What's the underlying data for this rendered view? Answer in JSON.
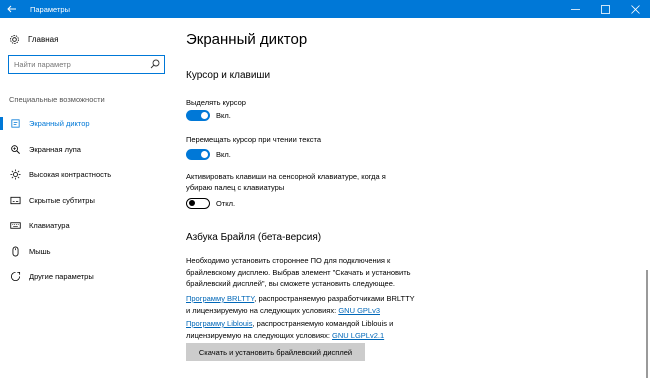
{
  "window": {
    "title": "Параметры",
    "back_icon": "back-arrow-icon",
    "controls": [
      "minimize",
      "maximize",
      "close"
    ]
  },
  "sidebar": {
    "home_label": "Главная",
    "search_placeholder": "Найти параметр",
    "section_header": "Специальные возможности",
    "items": [
      {
        "label": "Экранный диктор",
        "icon": "narrator-icon",
        "active": true
      },
      {
        "label": "Экранная лупа",
        "icon": "magnifier-icon",
        "active": false
      },
      {
        "label": "Высокая контрастность",
        "icon": "contrast-icon",
        "active": false
      },
      {
        "label": "Скрытые субтитры",
        "icon": "captions-icon",
        "active": false
      },
      {
        "label": "Клавиатура",
        "icon": "keyboard-icon",
        "active": false
      },
      {
        "label": "Мышь",
        "icon": "mouse-icon",
        "active": false
      },
      {
        "label": "Другие параметры",
        "icon": "other-options-icon",
        "active": false
      }
    ]
  },
  "main": {
    "page_title": "Экранный диктор",
    "cursor_section": {
      "title": "Курсор и клавиши",
      "settings": [
        {
          "label": "Выделять курсор",
          "state": "Вкл.",
          "on": true
        },
        {
          "label": "Перемещать курсор при чтении текста",
          "state": "Вкл.",
          "on": true
        },
        {
          "label_line1": "Активировать клавиши на сенсорной клавиатуре, когда я",
          "label_line2": "убираю палец с клавиатуры",
          "state": "Откл.",
          "on": false
        }
      ]
    },
    "braille_section": {
      "title": "Азбука Брайля (бета-версия)",
      "description_line1": "Необходимо установить стороннее ПО для подключения к",
      "description_line2": "брайлевскому дисплею. Выбрав элемент \"Скачать и установить",
      "description_line3": "брайлевский дисплей\", вы сможете установить следующее.",
      "brltty_link": "Программу BRLTTY",
      "brltty_text1": ", распространяемую разработчиками BRLTTY",
      "brltty_text2": "и лицензируемую на следующих условиях:",
      "brltty_license": "GNU GPLv3",
      "liblouis_link": "Программу Liblouis",
      "liblouis_text1": ", распространяемую командой Liblouis и",
      "liblouis_text2": "лицензируемую на следующих условиях:",
      "liblouis_license": "GNU LGPLv2.1",
      "button_label": "Скачать и установить брайлевский дисплей"
    }
  },
  "colors": {
    "accent": "#0078d7",
    "link": "#0067b8",
    "button_bg": "#cccccc"
  }
}
